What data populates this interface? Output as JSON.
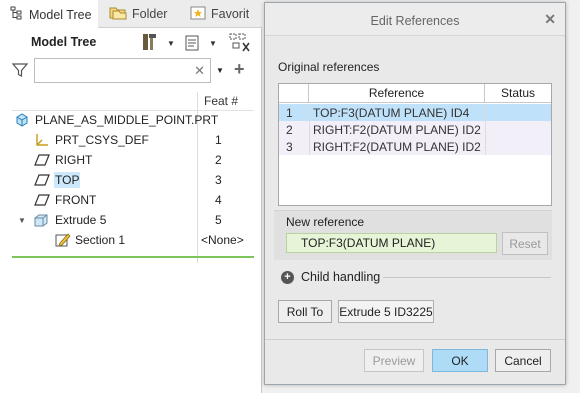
{
  "tabs": [
    {
      "label": "Model Tree",
      "icon": "tree-icon"
    },
    {
      "label": "Folder Browser",
      "icon": "folder-icon"
    },
    {
      "label": "Favorites",
      "icon": "star-icon"
    }
  ],
  "model_tree": {
    "title": "Model Tree",
    "search_placeholder": "",
    "column_header": "Feat #",
    "items": [
      {
        "label": "PLANE_AS_MIDDLE_POINT.PRT",
        "feat": "",
        "icon": "part-icon"
      },
      {
        "label": "PRT_CSYS_DEF",
        "feat": "1",
        "icon": "csys-icon"
      },
      {
        "label": "RIGHT",
        "feat": "2",
        "icon": "datum-plane-icon"
      },
      {
        "label": "TOP",
        "feat": "3",
        "icon": "datum-plane-icon"
      },
      {
        "label": "FRONT",
        "feat": "4",
        "icon": "datum-plane-icon"
      },
      {
        "label": "Extrude 5",
        "feat": "5",
        "icon": "extrude-icon"
      },
      {
        "label": "Section 1",
        "feat": "<None>",
        "icon": "sketch-icon"
      }
    ]
  },
  "dialog": {
    "title": "Edit References",
    "original_label": "Original references",
    "columns": {
      "reference": "Reference",
      "status": "Status"
    },
    "rows": [
      {
        "num": "1",
        "reference": "TOP:F3(DATUM PLANE) ID4",
        "status": ""
      },
      {
        "num": "2",
        "reference": "RIGHT:F2(DATUM PLANE) ID2",
        "status": ""
      },
      {
        "num": "3",
        "reference": "RIGHT:F2(DATUM PLANE) ID2",
        "status": ""
      }
    ],
    "new_reference_label": "New reference",
    "new_reference_value": "TOP:F3(DATUM PLANE)",
    "reset_label": "Reset",
    "child_handling_label": "Child handling",
    "roll_to_label": "Roll To",
    "roll_to_value": "Extrude 5 ID3225",
    "preview_label": "Preview",
    "ok_label": "OK",
    "cancel_label": "Cancel"
  },
  "colors": {
    "selection": "#bfe1f9",
    "new_reference_bg": "#e6f4d7",
    "ok_button": "#aedcf7",
    "tree_highlight": "#cde8fb",
    "insert_line": "#7bc55a"
  }
}
